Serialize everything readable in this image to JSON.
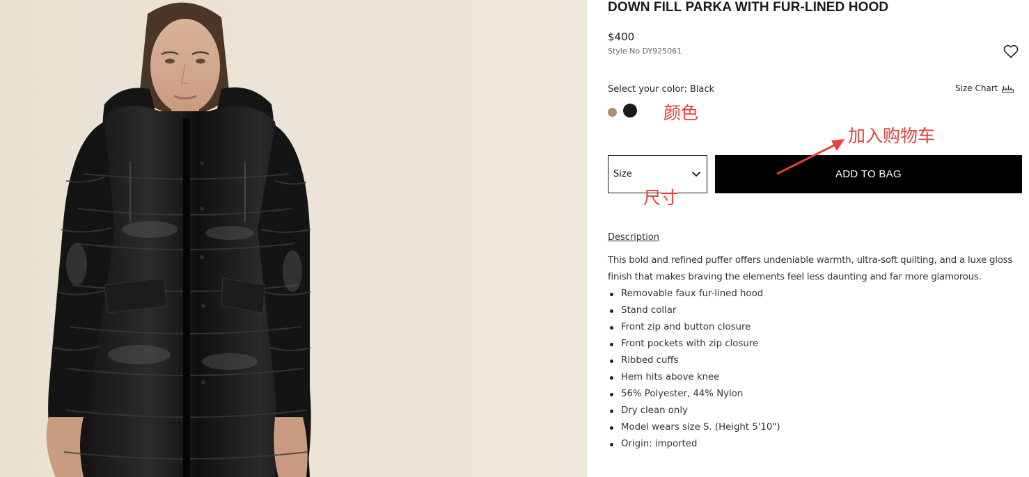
{
  "product": {
    "title": "DOWN FILL PARKA WITH FUR-LINED HOOD",
    "price": "$400",
    "style_label": "Style No",
    "style_number": "DY925061",
    "wishlist_icon": "heart-icon"
  },
  "color": {
    "label": "Select your color: Black",
    "swatches": [
      {
        "name": "camel",
        "hex": "#a89270"
      },
      {
        "name": "black",
        "hex": "#1a1a1a"
      }
    ]
  },
  "size_chart": {
    "label": "Size Chart",
    "icon": "ruler-icon"
  },
  "size_select": {
    "label": "Size",
    "icon": "chevron-down-icon"
  },
  "add_to_bag": {
    "label": "ADD TO BAG"
  },
  "description": {
    "heading": "Description",
    "text": "This bold and refined puffer offers undeniable warmth, ultra-soft quilting, and a luxe gloss finish that makes braving the elements feel less daunting and far more glamorous.",
    "features": [
      "Removable faux fur-lined hood",
      "Stand collar",
      "Front zip and button closure",
      "Front pockets with zip closure",
      "Ribbed cuffs",
      "Hem hits above knee",
      "56% Polyester, 44% Nylon",
      "Dry clean only",
      "Model wears size S. (Height 5'10\")",
      "Origin: imported"
    ]
  },
  "annotations": {
    "color": "颜色",
    "add_to_cart": "加入购物车",
    "size": "尺寸",
    "annotation_color_hex": "#e8403a"
  },
  "colors": {
    "image_background": "#e8e0d0",
    "button_background": "#000000",
    "button_text": "#ffffff"
  }
}
